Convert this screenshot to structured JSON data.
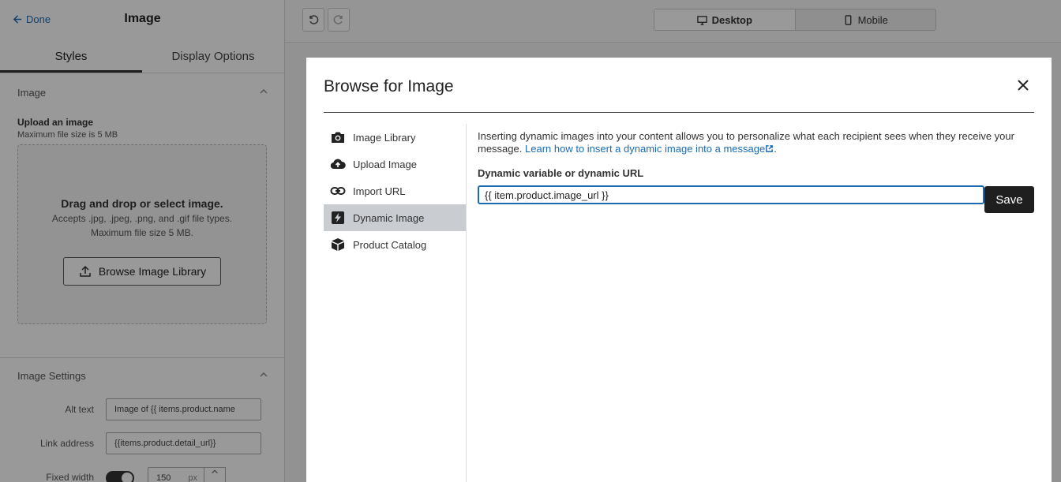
{
  "editor": {
    "done_label": "Done",
    "title": "Image",
    "tabs": [
      "Styles",
      "Display Options"
    ],
    "image_section": "Image",
    "upload_title": "Upload an image",
    "upload_subtitle": "Maximum file size is 5 MB",
    "dropzone_title": "Drag and drop or select image.",
    "dropzone_line1": "Accepts .jpg, .jpeg, .png, and .gif file types.",
    "dropzone_line2": "Maximum file size 5 MB.",
    "browse_button": "Browse Image Library",
    "settings_section": "Image Settings",
    "alt_text_label": "Alt text",
    "alt_text_value": "Image of {{ items.product.name",
    "link_label": "Link address",
    "link_value": "{{items.product.detail_url}}",
    "fixed_width_label": "Fixed width",
    "fixed_width_value": "150",
    "fixed_width_unit": "px"
  },
  "toolbar": {
    "desktop_label": "Desktop",
    "mobile_label": "Mobile"
  },
  "modal": {
    "title": "Browse for Image",
    "nav": [
      {
        "label": "Image Library",
        "icon": "camera-icon"
      },
      {
        "label": "Upload Image",
        "icon": "cloud-upload-icon"
      },
      {
        "label": "Import URL",
        "icon": "link-icon"
      },
      {
        "label": "Dynamic Image",
        "icon": "dynamic-image-icon",
        "active": true
      },
      {
        "label": "Product Catalog",
        "icon": "box-icon"
      }
    ],
    "intro_text": "Inserting dynamic images into your content allows you to personalize what each recipient sees when they receive your message.",
    "learn_link": "Learn how to insert a dynamic image into a message",
    "field_label": "Dynamic variable or dynamic URL",
    "field_value": "{{ item.product.image_url }}",
    "save_label": "Save"
  }
}
